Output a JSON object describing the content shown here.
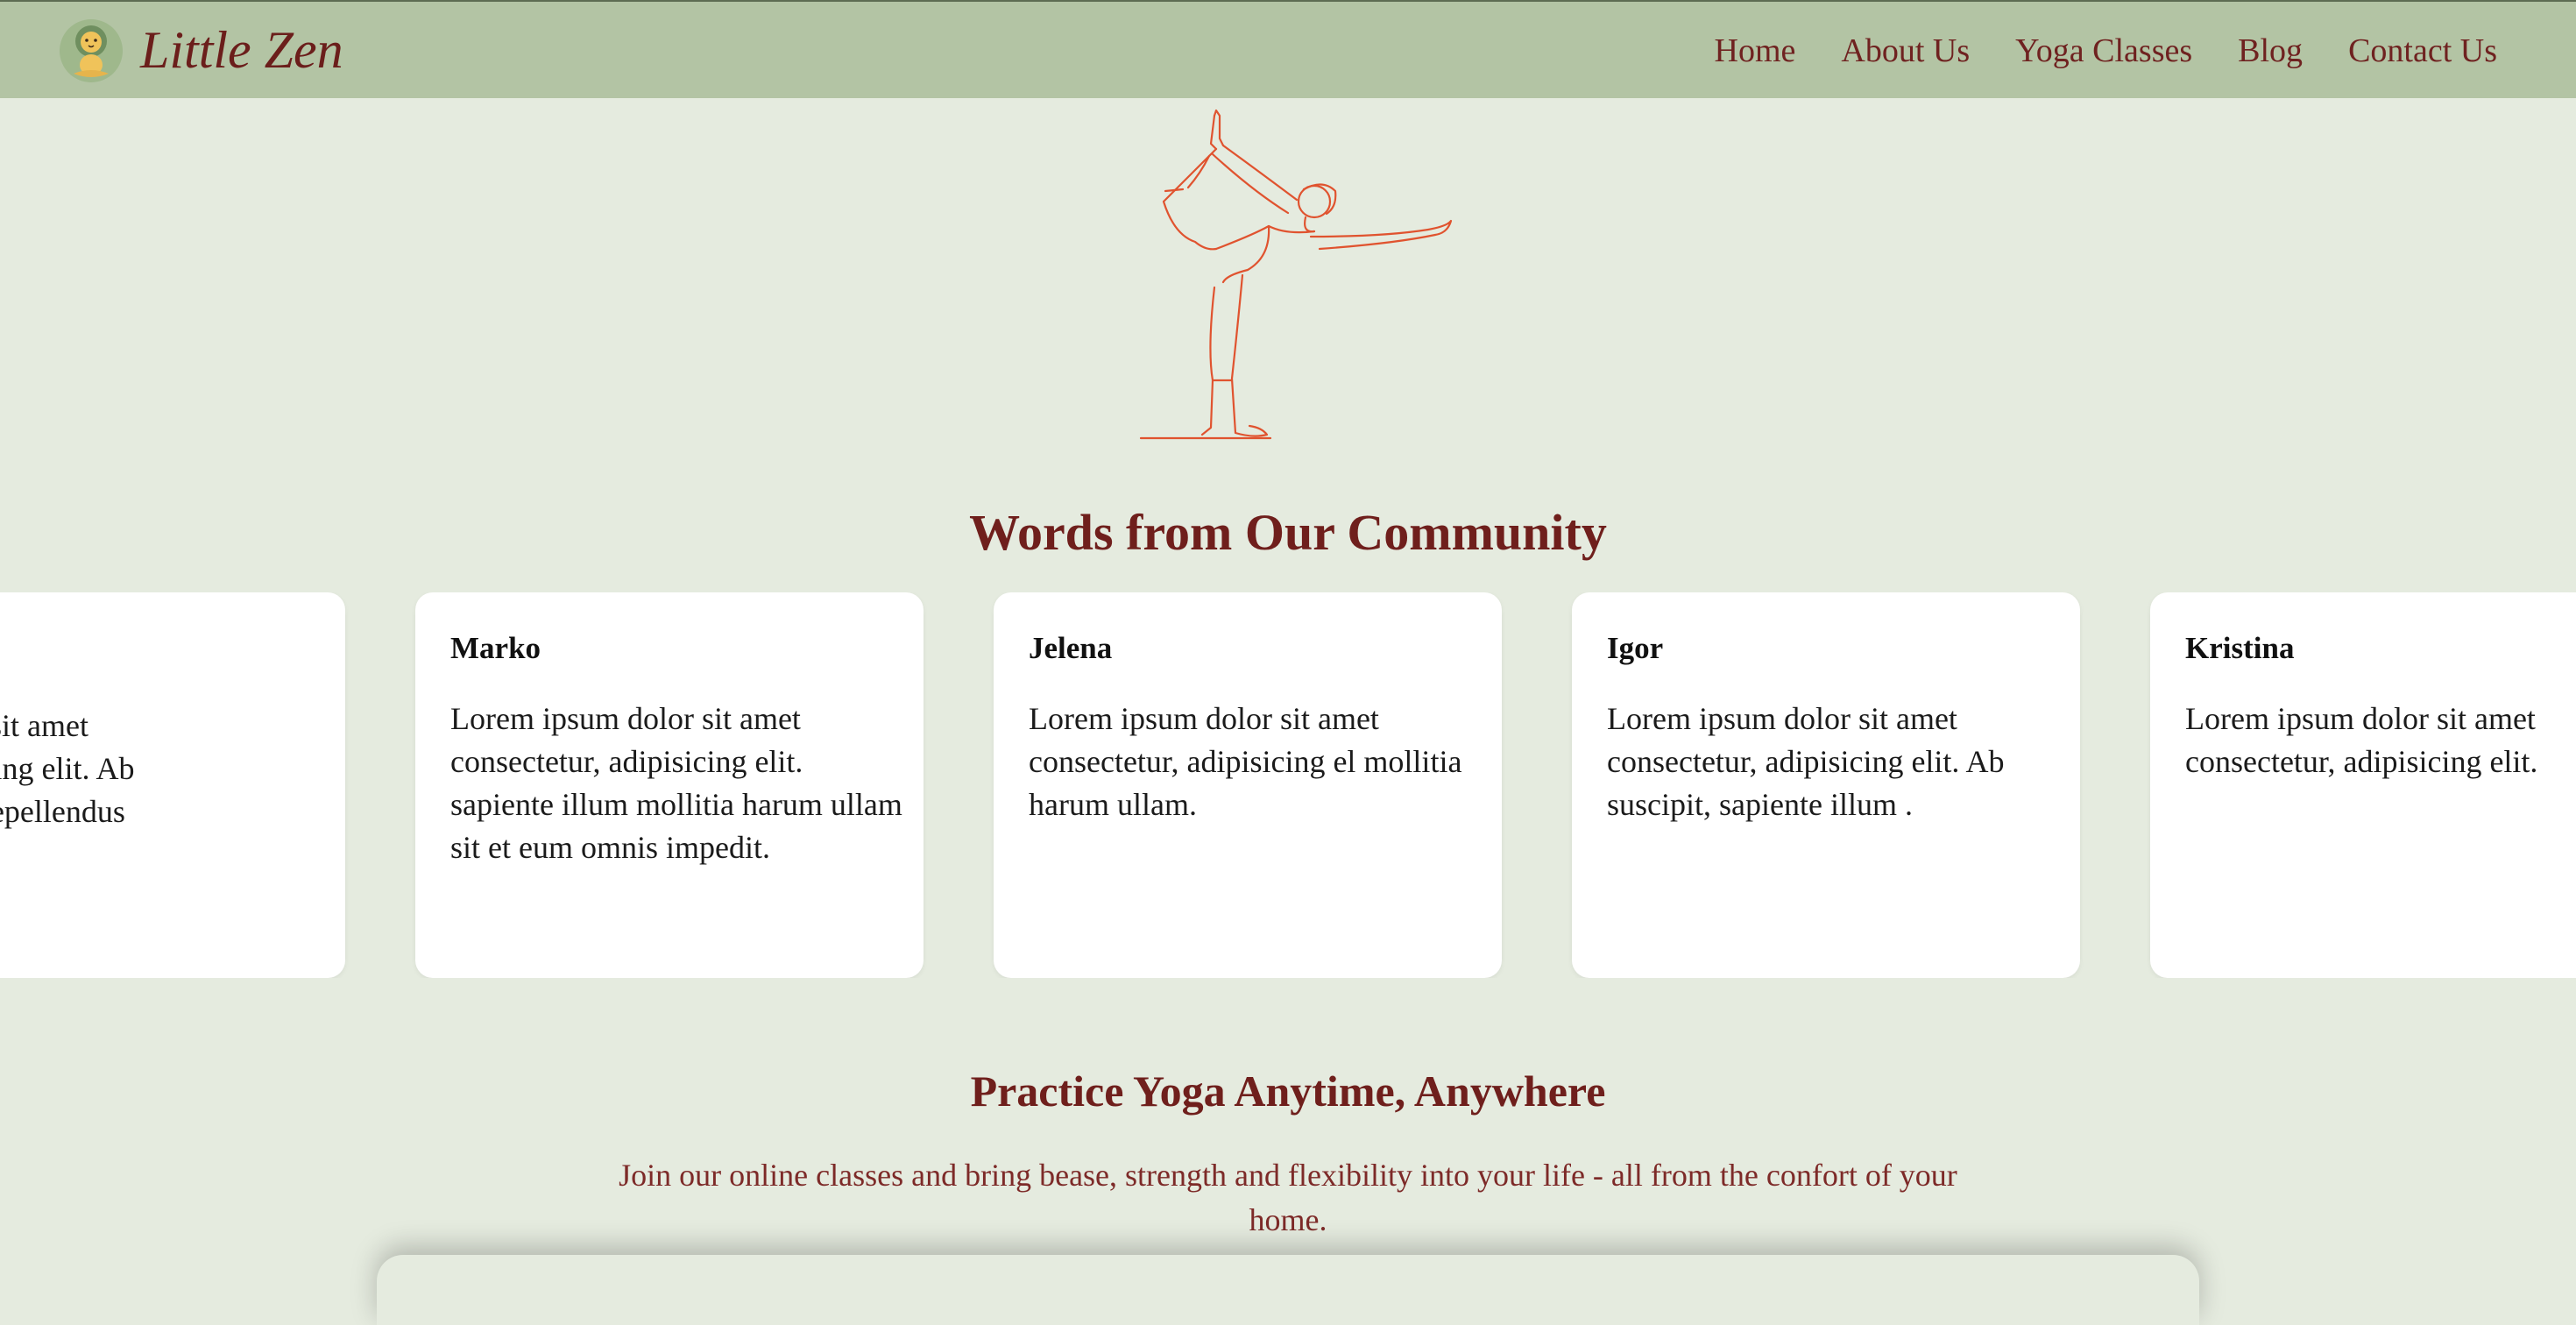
{
  "brand": {
    "name": "Little Zen"
  },
  "nav": {
    "items": [
      "Home",
      "About Us",
      "Yoga Classes",
      "Blog",
      "Contact Us"
    ]
  },
  "colors": {
    "nav_bg": "#b3c4a4",
    "page_bg": "#e5ebdf",
    "accent": "#6f1f1c",
    "illustration": "#e0532f"
  },
  "illustration": {
    "icon": "yoga-pose-illustration"
  },
  "testimonials": {
    "title": "Words from Our Community",
    "cards": [
      {
        "name": "",
        "text": "sum dolor sit amet\nur, adipisicing elit. Ab\nvoluptate repellendus\npiente"
      },
      {
        "name": "Marko",
        "text": "Lorem ipsum dolor sit amet consectetur, adipisicing elit. sapiente illum mollitia harum ullam sit et eum omnis impedit."
      },
      {
        "name": "Jelena",
        "text": "Lorem ipsum dolor sit amet consectetur, adipisicing el mollitia harum ullam."
      },
      {
        "name": "Igor",
        "text": "Lorem ipsum dolor sit amet consectetur, adipisicing elit. Ab suscipit, sapiente illum ."
      },
      {
        "name": "Kristina",
        "text": "Lorem ipsum dolor sit amet consectetur, adipisicing elit."
      }
    ]
  },
  "practice": {
    "title": "Practice Yoga Anytime, Anywhere",
    "subtitle": "Join our online classes and bring bease, strength and flexibility into your life - all from the confort of your home."
  }
}
